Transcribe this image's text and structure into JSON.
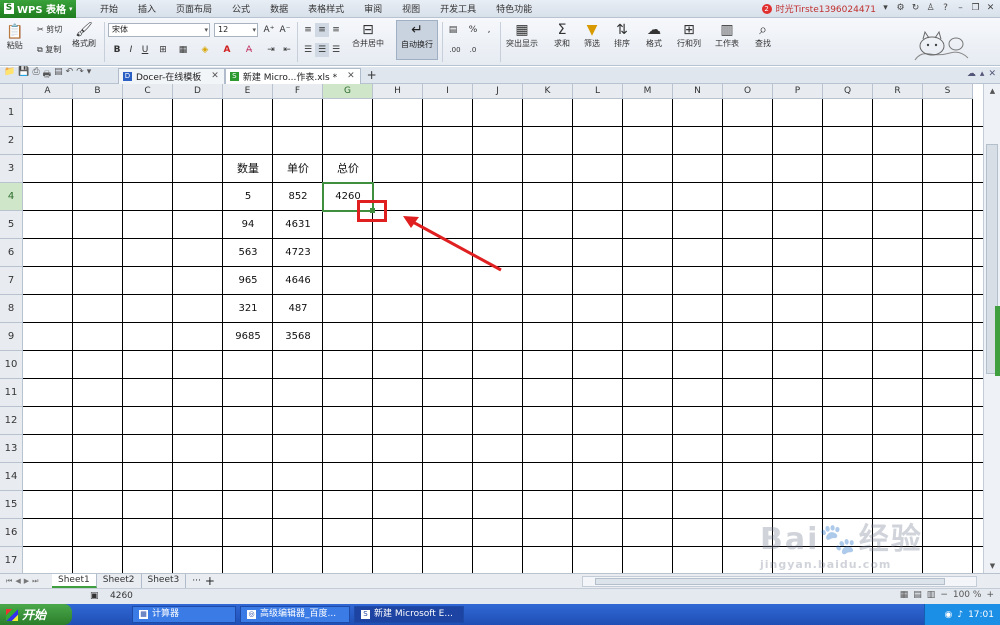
{
  "app": {
    "name": "WPS 表格"
  },
  "menu": [
    "开始",
    "插入",
    "页面布局",
    "公式",
    "数据",
    "表格样式",
    "审阅",
    "视图",
    "开发工具",
    "特色功能"
  ],
  "account": {
    "notification_count": "2",
    "user": "时光Tirste1396024471"
  },
  "ribbon": {
    "paste": "粘贴",
    "cut": "剪切",
    "copy": "复制",
    "format_painter": "格式刷",
    "font_name": "宋体",
    "font_size": "12",
    "merge_center": "合并居中",
    "wrap_text": "自动换行",
    "conditional_format": "突出显示",
    "sum": "求和",
    "filter": "筛选",
    "sort": "排序",
    "format": "格式",
    "rows_cols": "行和列",
    "worksheet": "工作表",
    "find": "查找"
  },
  "tabs": [
    {
      "label": "Docer-在线模板",
      "active": false
    },
    {
      "label": "新建 Micro...作表.xls *",
      "active": true
    }
  ],
  "columns": [
    "A",
    "B",
    "C",
    "D",
    "E",
    "F",
    "G",
    "H",
    "I",
    "J",
    "K",
    "L",
    "M",
    "N",
    "O",
    "P",
    "Q",
    "R",
    "S"
  ],
  "rows": [
    "1",
    "2",
    "3",
    "4",
    "5",
    "6",
    "7",
    "8",
    "9",
    "10",
    "11",
    "12",
    "13",
    "14",
    "15",
    "16",
    "17"
  ],
  "table": {
    "headers": [
      "数量",
      "单价",
      "总价"
    ],
    "data": [
      [
        "5",
        "852",
        "4260"
      ],
      [
        "94",
        "4631",
        ""
      ],
      [
        "563",
        "4723",
        ""
      ],
      [
        "965",
        "4646",
        ""
      ],
      [
        "321",
        "487",
        ""
      ],
      [
        "9685",
        "3568",
        ""
      ]
    ]
  },
  "active_cell": "G4",
  "sheets": [
    {
      "label": "Sheet1",
      "active": true
    },
    {
      "label": "Sheet2",
      "active": false
    },
    {
      "label": "Sheet3",
      "active": false
    }
  ],
  "status": {
    "value": "4260",
    "zoom": "100 %"
  },
  "taskbar": {
    "start": "开始",
    "items": [
      {
        "label": "计算器",
        "active": false
      },
      {
        "label": "高级编辑器_百度...",
        "active": false
      },
      {
        "label": "新建 Microsoft E...",
        "active": true
      }
    ],
    "clock": "17:01"
  },
  "colors": {
    "accent": "#3f8f3f",
    "highlight": "#e02020",
    "taskbar": "#2559c4"
  }
}
